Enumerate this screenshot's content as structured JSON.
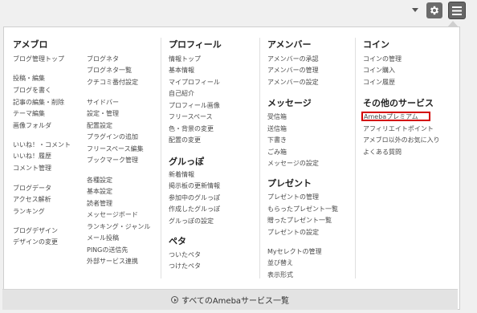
{
  "menu": {
    "col1": {
      "heading": "アメブロ",
      "left": [
        "ブログ管理トップ",
        "投稿・編集",
        "ブログを書く",
        "記事の編集・削除",
        "テーマ編集",
        "画像フォルダ",
        "いいね！・コメント",
        "いいね！履歴",
        "コメント管理",
        "ブログデータ",
        "アクセス解析",
        "ランキング",
        "ブログデザイン",
        "デザインの変更"
      ],
      "right": [
        "ブログネタ",
        "ブログネタ一覧",
        "クチコミ番付設定",
        "サイドバー",
        "設定・管理",
        "配置設定",
        "プラグインの追加",
        "フリースペース編集",
        "ブックマーク管理",
        "各種設定",
        "基本設定",
        "読者管理",
        "メッセージボード",
        "ランキング・ジャンル",
        "メール投稿",
        "PINGの送信先",
        "外部サービス連携"
      ]
    },
    "col2": {
      "heading_profile": "プロフィール",
      "profile": [
        "情報トップ",
        "基本情報",
        "マイプロフィール",
        "自己紹介",
        "プロフィール画像",
        "フリースペース",
        "色・背景の変更",
        "配置の変更"
      ],
      "heading_group": "グルっぽ",
      "group": [
        "新着情報",
        "掲示板の更新情報",
        "参加中のグルっぽ",
        "作成したグルっぽ",
        "グルっぽの設定"
      ],
      "heading_peta": "ペタ",
      "peta": [
        "ついたペタ",
        "つけたペタ"
      ]
    },
    "col3": {
      "heading_member": "アメンバー",
      "member": [
        "アメンバーの承認",
        "アメンバーの管理",
        "アメンバーの設定"
      ],
      "heading_message": "メッセージ",
      "message": [
        "受信箱",
        "送信箱",
        "下書き",
        "ごみ箱",
        "メッセージの設定"
      ],
      "heading_present": "プレゼント",
      "present": [
        "プレゼントの管理",
        "もらったプレゼント一覧",
        "贈ったプレゼント一覧",
        "プレゼントの設定"
      ],
      "myselect": [
        "Myセレクトの管理",
        "並び替え",
        "表示形式"
      ]
    },
    "col4": {
      "heading_coin": "コイン",
      "coin": [
        "コインの管理",
        "コイン購入",
        "コイン履歴"
      ],
      "heading_other": "その他のサービス",
      "other": [
        "Amebaプレミアム",
        "アフィリエイトポイント",
        "アメブロ以外のお気に入り",
        "よくある質問"
      ]
    }
  },
  "footer": {
    "label": "すべてのAmebaサービス一覧"
  },
  "icons": {
    "gear": "gear-icon",
    "menu": "hamburger-menu-icon",
    "dropdown": "chevron-down-icon",
    "footer": "play-circle-icon"
  }
}
